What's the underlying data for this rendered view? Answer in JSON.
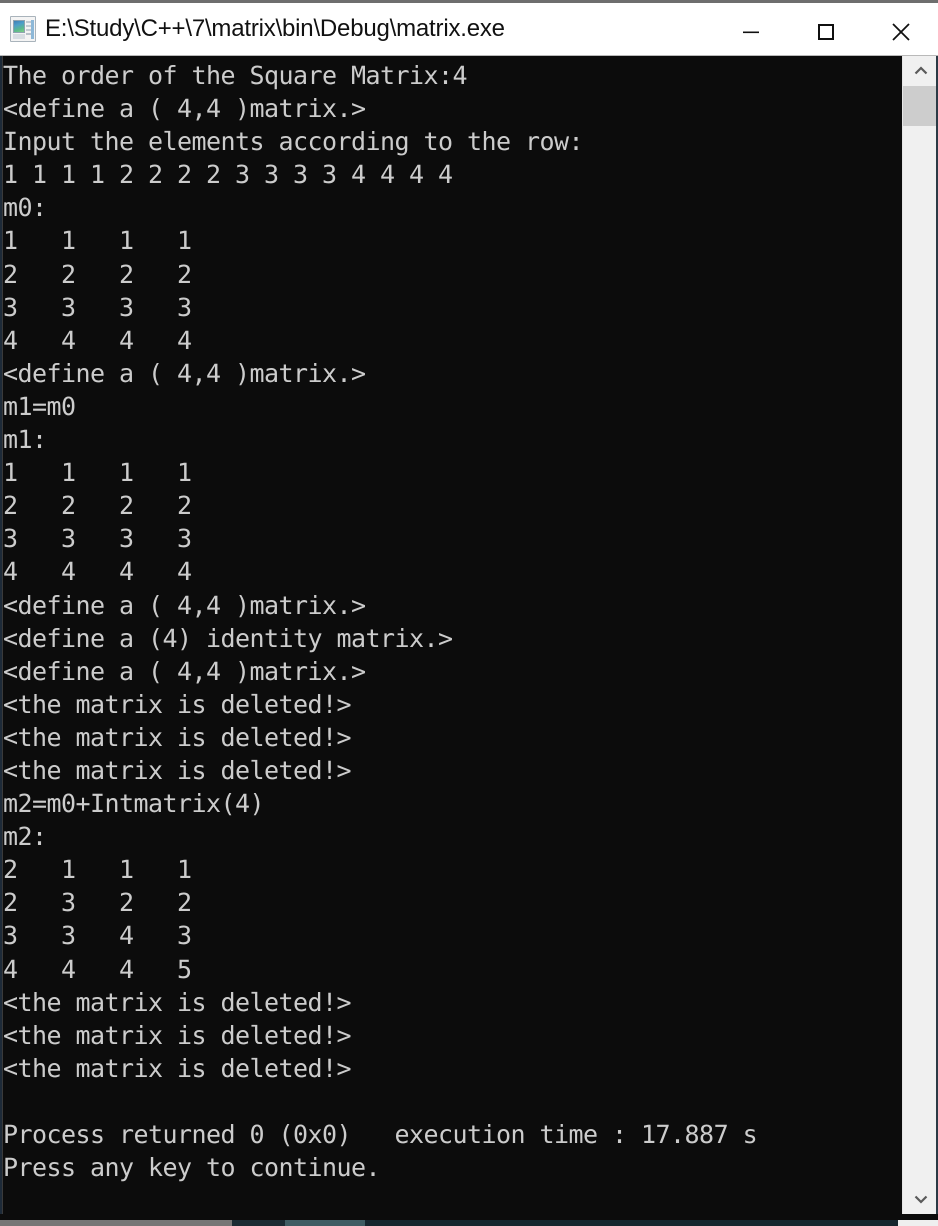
{
  "window": {
    "title": "E:\\Study\\C++\\7\\matrix\\bin\\Debug\\matrix.exe",
    "icon": "console-app-icon",
    "background_color": "#0c0c0c",
    "text_color": "#cccccc",
    "titlebar_color": "#ffffff"
  },
  "caption_buttons": {
    "minimize": "minimize-icon",
    "maximize": "maximize-icon",
    "close": "close-icon"
  },
  "scrollbar": {
    "up_arrow": "chevron-up-icon",
    "down_arrow": "chevron-down-icon",
    "thumb": "scrollbar-thumb"
  },
  "console": {
    "lines": [
      "The order of the Square Matrix:4",
      "<define a ( 4,4 )matrix.>",
      "Input the elements according to the row:",
      "1 1 1 1 2 2 2 2 3 3 3 3 4 4 4 4",
      "m0:",
      "1   1   1   1",
      "2   2   2   2",
      "3   3   3   3",
      "4   4   4   4",
      "<define a ( 4,4 )matrix.>",
      "m1=m0",
      "m1:",
      "1   1   1   1",
      "2   2   2   2",
      "3   3   3   3",
      "4   4   4   4",
      "<define a ( 4,4 )matrix.>",
      "<define a (4) identity matrix.>",
      "<define a ( 4,4 )matrix.>",
      "<the matrix is deleted!>",
      "<the matrix is deleted!>",
      "<the matrix is deleted!>",
      "m2=m0+Intmatrix(4)",
      "m2:",
      "2   1   1   1",
      "2   3   2   2",
      "3   3   4   3",
      "4   4   4   5",
      "<the matrix is deleted!>",
      "<the matrix is deleted!>",
      "<the matrix is deleted!>",
      "",
      "Process returned 0 (0x0)   execution time : 17.887 s",
      "Press any key to continue."
    ]
  }
}
